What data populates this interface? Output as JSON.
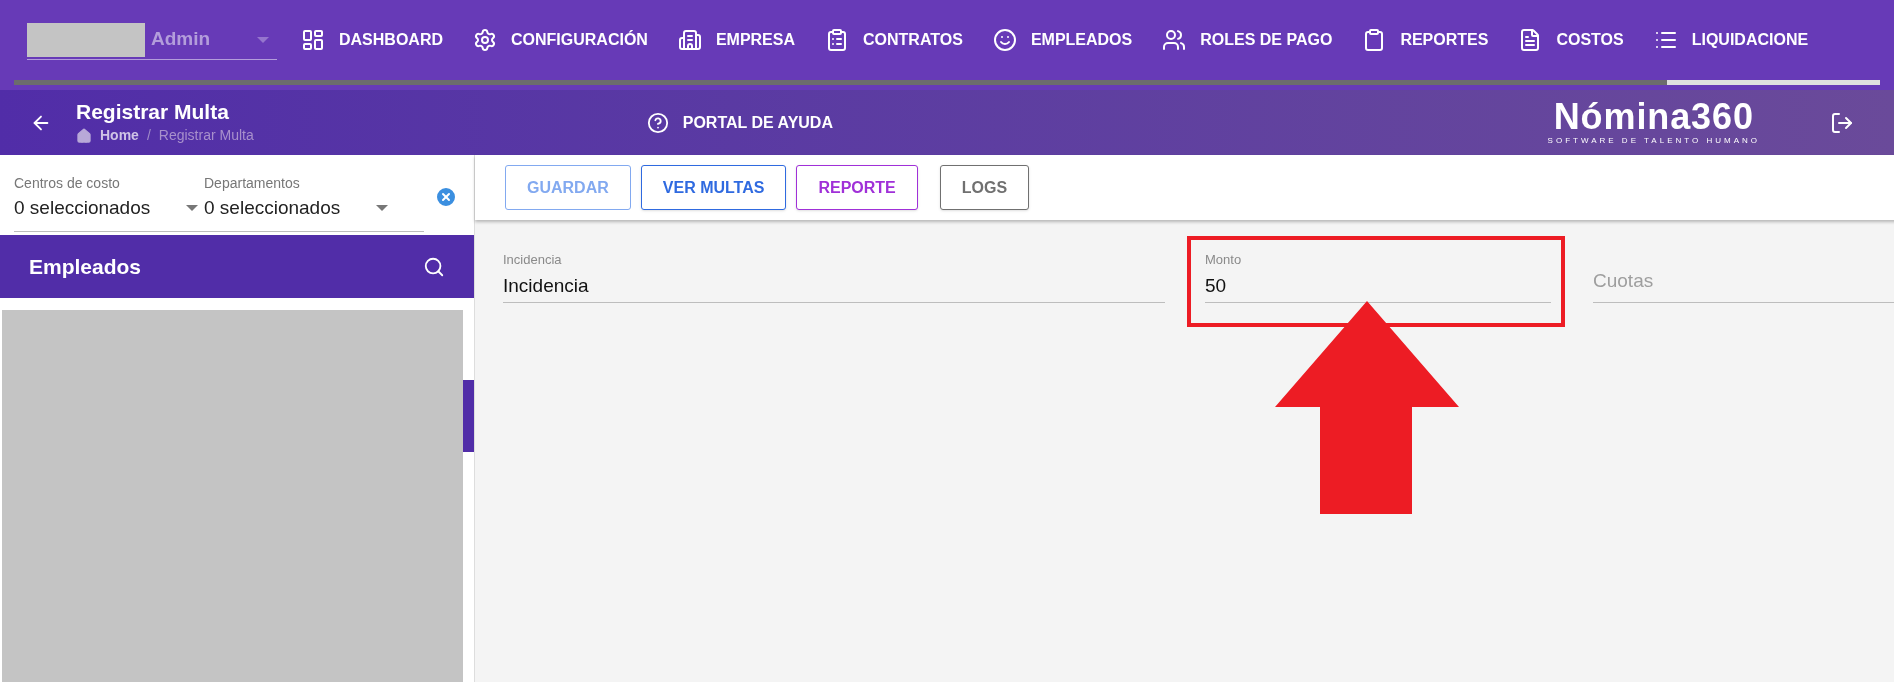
{
  "user_menu": {
    "role": "Admin"
  },
  "nav": [
    {
      "label": "DASHBOARD"
    },
    {
      "label": "CONFIGURACIÓN"
    },
    {
      "label": "EMPRESA"
    },
    {
      "label": "CONTRATOS"
    },
    {
      "label": "EMPLEADOS"
    },
    {
      "label": "ROLES DE PAGO"
    },
    {
      "label": "REPORTES"
    },
    {
      "label": "COSTOS"
    },
    {
      "label": "LIQUIDACIONE"
    }
  ],
  "header": {
    "title": "Registrar Multa",
    "breadcrumb": [
      "Home",
      "Registrar Multa"
    ],
    "breadcrumb_separator": "/",
    "help": "PORTAL DE AYUDA",
    "logo": "Nómina360",
    "tagline": "SOFTWARE DE TALENTO HUMANO"
  },
  "filters": [
    {
      "label": "Centros de costo",
      "value": "0 seleccionados"
    },
    {
      "label": "Departamentos",
      "value": "0 seleccionados"
    }
  ],
  "panel": {
    "title": "Empleados"
  },
  "toolbar": [
    {
      "label": "GUARDAR",
      "color": "#82a9f0",
      "disabled": true
    },
    {
      "label": "VER MULTAS",
      "color": "#2f6ae0",
      "disabled": false
    },
    {
      "label": "REPORTE",
      "color": "#a030d8",
      "disabled": false
    },
    {
      "label": "LOGS",
      "color": "#707070",
      "disabled": false
    }
  ],
  "fields": [
    {
      "label": "Incidencia",
      "value": "Incidencia",
      "highlighted": false
    },
    {
      "label": "Monto",
      "value": "50",
      "highlighted": true
    },
    {
      "placeholder": "Cuotas",
      "highlighted": false
    }
  ]
}
